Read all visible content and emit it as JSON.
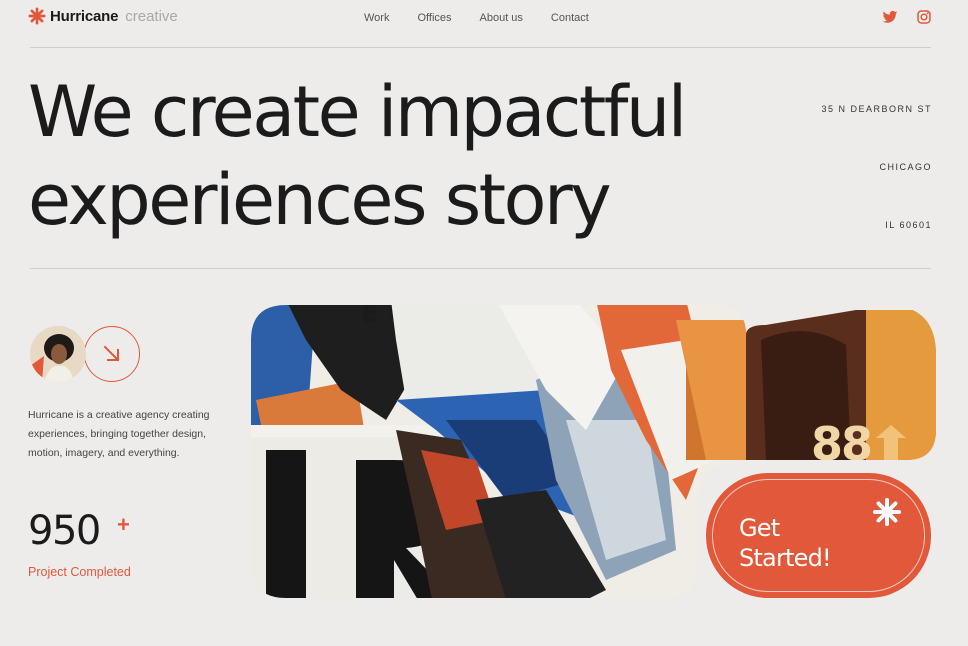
{
  "brand": {
    "name": "Hurricane",
    "sub": "creative"
  },
  "nav": {
    "items": [
      "Work",
      "Offices",
      "About us",
      "Contact"
    ]
  },
  "social": [
    "twitter-icon",
    "instagram-icon"
  ],
  "hero": {
    "line1": "We create impactful",
    "line2": "experiences story"
  },
  "address": {
    "street": "35 N DEARBORN ST",
    "city": "CHICAGO",
    "zip": "IL 60601"
  },
  "intro": {
    "description": "Hurricane is a creative agency creating experiences, bringing together design, motion, imagery, and everything."
  },
  "stats": {
    "value": "950",
    "suffix": "+",
    "label": "Project Completed"
  },
  "cta": {
    "label": "Get Started!"
  },
  "colors": {
    "accent": "#e2583a",
    "background": "#eeeceb",
    "text": "#1b1b1b"
  }
}
